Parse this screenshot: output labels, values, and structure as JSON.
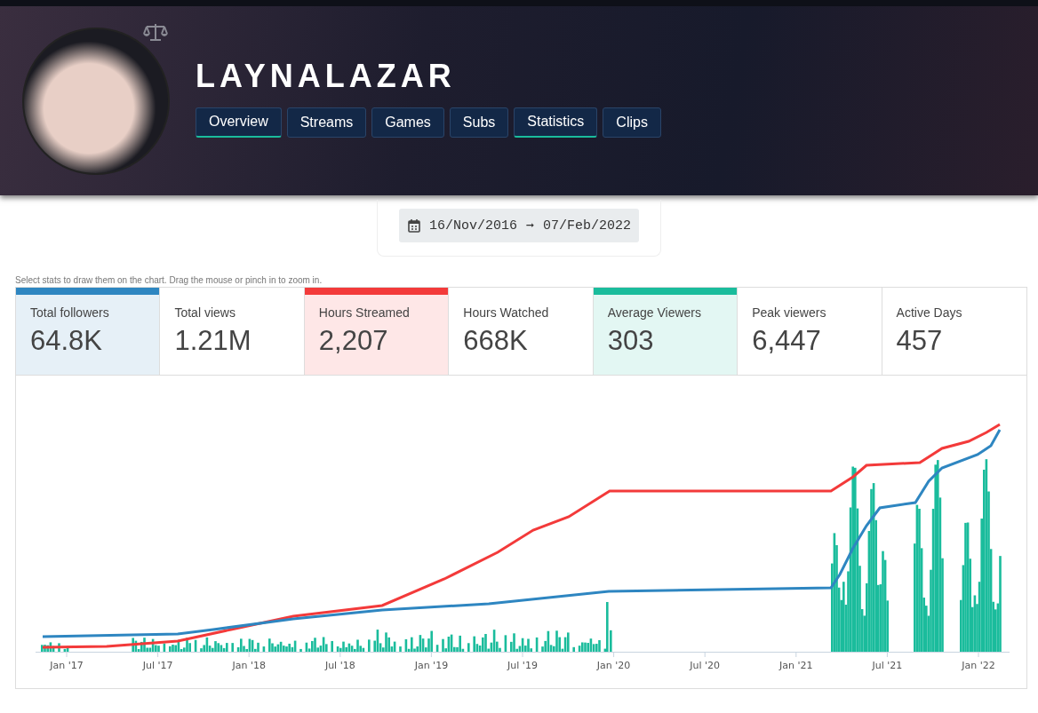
{
  "channel": {
    "name": "LAYNALAZAR"
  },
  "tabs": [
    {
      "label": "Overview",
      "selected": true
    },
    {
      "label": "Streams",
      "selected": false
    },
    {
      "label": "Games",
      "selected": false
    },
    {
      "label": "Subs",
      "selected": false
    },
    {
      "label": "Statistics",
      "selected": true
    },
    {
      "label": "Clips",
      "selected": false
    }
  ],
  "date_range": {
    "start": "16/Nov/2016",
    "arrow": "➞",
    "end": "07/Feb/2022"
  },
  "hint": "Select stats to draw them on the chart. Drag the mouse or pinch in to zoom in.",
  "stats": [
    {
      "label": "Total followers",
      "value": "64.8K",
      "selected": true,
      "color": "#2e86c1"
    },
    {
      "label": "Total views",
      "value": "1.21M",
      "selected": false
    },
    {
      "label": "Hours Streamed",
      "value": "2,207",
      "selected": true,
      "color": "#f33a3a"
    },
    {
      "label": "Hours Watched",
      "value": "668K",
      "selected": false
    },
    {
      "label": "Average Viewers",
      "value": "303",
      "selected": true,
      "color": "#1abc9c"
    },
    {
      "label": "Peak viewers",
      "value": "6,447",
      "selected": false
    },
    {
      "label": "Active Days",
      "value": "457",
      "selected": false
    }
  ],
  "chart": {
    "x_axis_labels": [
      "Jan '17",
      "Jul '17",
      "Jan '18",
      "Jul '18",
      "Jan '19",
      "Jul '19",
      "Jan '20",
      "Jul '20",
      "Jan '21",
      "Jul '21",
      "Jan '22"
    ]
  }
}
